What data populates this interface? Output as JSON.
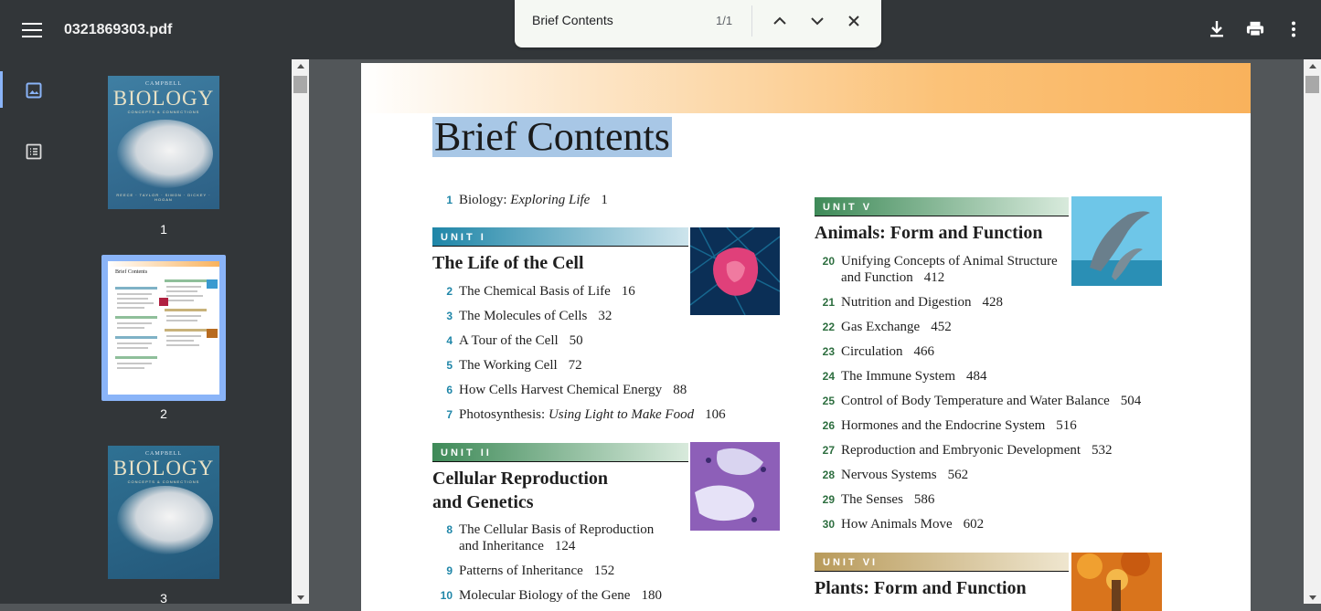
{
  "toolbar": {
    "filename": "0321869303.pdf",
    "menu_icon": "hamburger-menu-icon",
    "download_icon": "download-icon",
    "print_icon": "print-icon",
    "more_icon": "more-vert-icon"
  },
  "find": {
    "query": "Brief Contents",
    "count": "1/1"
  },
  "sidebar": {
    "tabs": [
      "thumbnails-tab-icon",
      "outline-tab-icon"
    ],
    "thumbnails": [
      {
        "page": "1",
        "campbell": "CAMPBELL",
        "title": "BIOLOGY",
        "subtitle": "CONCEPTS & CONNECTIONS",
        "authors": "REECE · TAYLOR · SIMON · DICKEY · HOGAN"
      },
      {
        "page": "2",
        "mini_title": "Brief Contents"
      },
      {
        "page": "3",
        "campbell": "CAMPBELL",
        "title": "BIOLOGY",
        "subtitle": "CONCEPTS & CONNECTIONS",
        "authors": ""
      }
    ]
  },
  "doc": {
    "heading": "Brief Contents",
    "ch1": {
      "num": "1",
      "title": "Biology: ",
      "title_italic": "Exploring Life",
      "page": "1"
    },
    "unit1": {
      "label": "UNIT I",
      "title": "The Life of the Cell",
      "chapters": [
        {
          "num": "2",
          "title": "The Chemical Basis of Life",
          "page": "16"
        },
        {
          "num": "3",
          "title": "The Molecules of Cells",
          "page": "32"
        },
        {
          "num": "4",
          "title": "A Tour of the Cell",
          "page": "50"
        },
        {
          "num": "5",
          "title": "The Working Cell",
          "page": "72"
        },
        {
          "num": "6",
          "title": "How Cells Harvest Chemical Energy",
          "page": "88"
        }
      ],
      "ch7": {
        "num": "7",
        "title": "Photosynthesis: ",
        "title_italic": "Using Light to Make Food",
        "page": "106"
      }
    },
    "unit2": {
      "label": "UNIT II",
      "title_line1": "Cellular Reproduction",
      "title_line2": "and Genetics",
      "ch8": {
        "num": "8",
        "title_line1": "The Cellular Basis of Reproduction",
        "title_line2": "and Inheritance",
        "page": "124"
      },
      "chapters": [
        {
          "num": "9",
          "title": "Patterns of Inheritance",
          "page": "152"
        },
        {
          "num": "10",
          "title": "Molecular Biology of the Gene",
          "page": "180"
        }
      ]
    },
    "unit5": {
      "label": "UNIT V",
      "title": "Animals: Form and Function",
      "ch20": {
        "num": "20",
        "title_line1": "Unifying Concepts of Animal Structure",
        "title_line2": "and Function",
        "page": "412"
      },
      "chapters": [
        {
          "num": "21",
          "title": "Nutrition and Digestion",
          "page": "428"
        },
        {
          "num": "22",
          "title": "Gas Exchange",
          "page": "452"
        },
        {
          "num": "23",
          "title": "Circulation",
          "page": "466"
        },
        {
          "num": "24",
          "title": "The Immune System",
          "page": "484"
        },
        {
          "num": "25",
          "title": "Control of Body Temperature and Water Balance",
          "page": "504"
        },
        {
          "num": "26",
          "title": "Hormones and the Endocrine System",
          "page": "516"
        },
        {
          "num": "27",
          "title": "Reproduction and Embryonic Development",
          "page": "532"
        },
        {
          "num": "28",
          "title": "Nervous Systems",
          "page": "562"
        },
        {
          "num": "29",
          "title": "The Senses",
          "page": "586"
        },
        {
          "num": "30",
          "title": "How Animals Move",
          "page": "602"
        }
      ]
    },
    "unit6": {
      "label": "UNIT VI",
      "title": "Plants: Form and Function"
    }
  },
  "colors": {
    "toolbar_bg": "#323639",
    "viewer_bg": "#525659",
    "highlight": "#a8c7e6",
    "unit_blue": "#1f86a8",
    "unit_green": "#2d6e3f"
  }
}
